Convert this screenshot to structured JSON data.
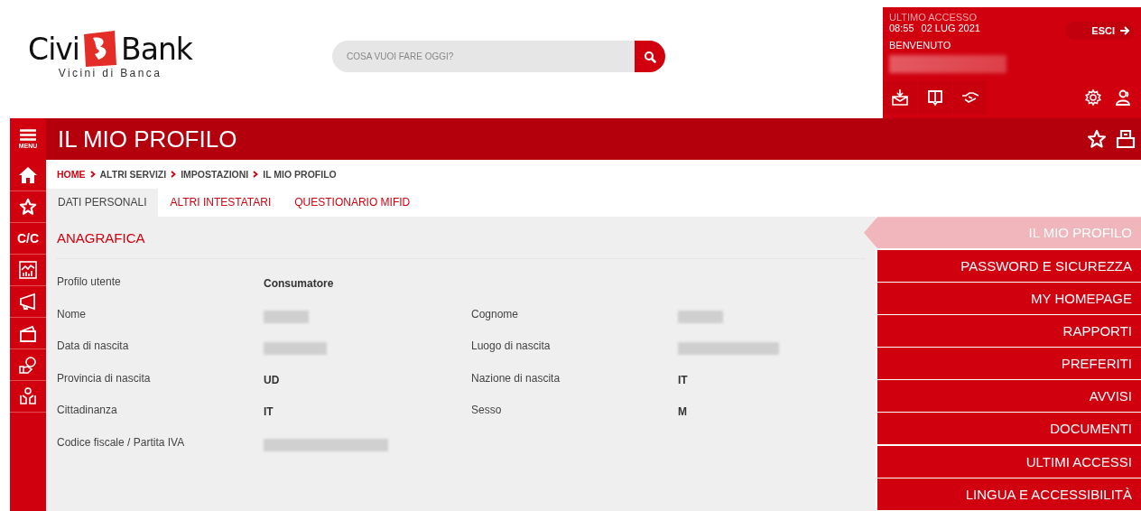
{
  "logo": {
    "name_left": "Civi",
    "name_right": "Bank",
    "tagline": "Vicini di Banca"
  },
  "search": {
    "placeholder": "COSA VUOI FARE OGGI?"
  },
  "user_panel": {
    "last_access_label": "ULTIMO ACCESSO",
    "last_access_time": "08:55",
    "last_access_date": "02 LUG 2021",
    "welcome": "BENVENUTO",
    "logout": "ESCI"
  },
  "menu_label": "MENU",
  "page_title": "IL MIO PROFILO",
  "sidebar_text": "C/C",
  "breadcrumb": [
    {
      "label": "HOME",
      "link": true
    },
    {
      "label": "ALTRI SERVIZI",
      "link": false
    },
    {
      "label": "IMPOSTAZIONI",
      "link": false
    },
    {
      "label": "IL MIO PROFILO",
      "link": false
    }
  ],
  "tabs": [
    {
      "label": "DATI PERSONALI",
      "selected": true
    },
    {
      "label": "ALTRI INTESTATARI",
      "selected": false
    },
    {
      "label": "QUESTIONARIO MIFID",
      "selected": false
    }
  ],
  "section_title": "ANAGRAFICA",
  "rows": [
    [
      {
        "label": "Profilo utente",
        "kind": "text",
        "value": "Consumatore"
      }
    ],
    [
      {
        "label": "Nome",
        "kind": "redacted"
      },
      {
        "label": "Cognome",
        "kind": "redacted"
      }
    ],
    [
      {
        "label": "Data di nascita",
        "kind": "redacted"
      },
      {
        "label": "Luogo di nascita",
        "kind": "redacted"
      }
    ],
    [
      {
        "label": "Provincia di nascita",
        "kind": "text",
        "value": "UD"
      },
      {
        "label": "Nazione di nascita",
        "kind": "text",
        "value": "IT"
      }
    ],
    [
      {
        "label": "Cittadinanza",
        "kind": "text",
        "value": "IT"
      },
      {
        "label": "Sesso",
        "kind": "text",
        "value": "M"
      }
    ],
    [
      {
        "label": "Codice fiscale / Partita IVA",
        "kind": "redacted"
      }
    ]
  ],
  "side_menu": [
    {
      "label": "IL MIO PROFILO",
      "selected": true
    },
    {
      "label": "PASSWORD E SICUREZZA",
      "selected": false
    },
    {
      "label": "MY HOMEPAGE",
      "selected": false
    },
    {
      "label": "RAPPORTI",
      "selected": false
    },
    {
      "label": "PREFERITI",
      "selected": false
    },
    {
      "label": "AVVISI",
      "selected": false
    },
    {
      "label": "DOCUMENTI",
      "selected": false
    },
    {
      "label": "ULTIMI ACCESSI",
      "selected": false
    },
    {
      "label": "LINGUA E ACCESSIBILITÀ",
      "selected": false
    }
  ]
}
